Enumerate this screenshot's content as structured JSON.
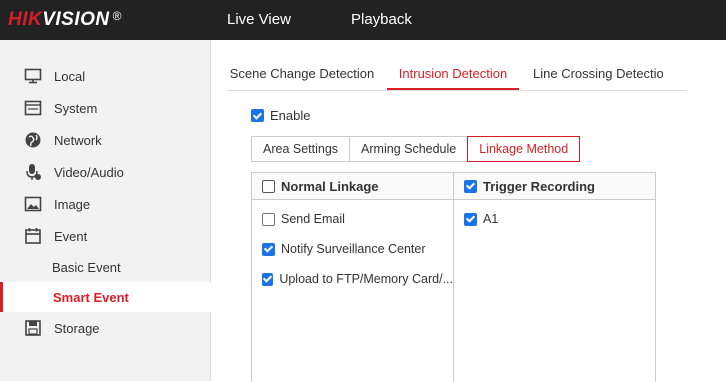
{
  "header": {
    "brand_main": "HIK",
    "brand_rest": "VISION",
    "registered": "®",
    "nav": [
      {
        "label": "Live View"
      },
      {
        "label": "Playback"
      }
    ]
  },
  "sidebar": {
    "items": [
      {
        "label": "Local",
        "icon": "monitor-icon"
      },
      {
        "label": "System",
        "icon": "system-icon"
      },
      {
        "label": "Network",
        "icon": "globe-icon"
      },
      {
        "label": "Video/Audio",
        "icon": "microphone-icon"
      },
      {
        "label": "Image",
        "icon": "image-icon"
      },
      {
        "label": "Event",
        "icon": "calendar-icon"
      }
    ],
    "sub_items": [
      {
        "label": "Basic Event"
      },
      {
        "label": "Smart Event"
      }
    ],
    "after": [
      {
        "label": "Storage",
        "icon": "floppy-icon"
      }
    ]
  },
  "tabs": [
    {
      "label": "Scene Change Detection"
    },
    {
      "label": "Intrusion Detection"
    },
    {
      "label": "Line Crossing Detectio"
    }
  ],
  "enable": {
    "label": "Enable",
    "checked": true
  },
  "crumbs": [
    {
      "label": "Area Settings"
    },
    {
      "label": "Arming Schedule"
    },
    {
      "label": "Linkage Method"
    }
  ],
  "linkage": {
    "normal": {
      "header": "Normal Linkage",
      "rows": [
        {
          "label": "Send Email",
          "checked": false
        },
        {
          "label": "Notify Surveillance Center",
          "checked": true
        },
        {
          "label": "Upload to FTP/Memory Card/...",
          "checked": true
        }
      ]
    },
    "trigger": {
      "header": "Trigger Recording",
      "rows": [
        {
          "label": "A1",
          "checked": true
        }
      ]
    }
  },
  "colors": {
    "accent": "#d71f27",
    "checkbox": "#1a73e8"
  }
}
